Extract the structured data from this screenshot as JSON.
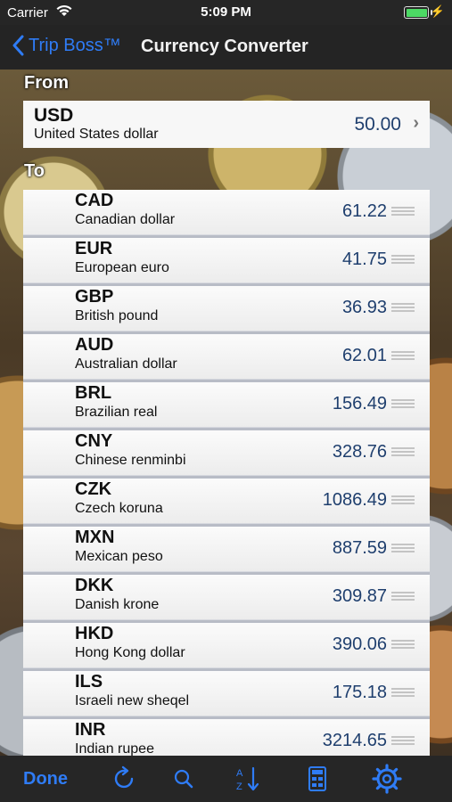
{
  "status": {
    "carrier": "Carrier",
    "time": "5:09 PM"
  },
  "nav": {
    "back_label": "Trip Boss™",
    "title": "Currency Converter"
  },
  "from": {
    "section_label": "From",
    "code": "USD",
    "name": "United States dollar",
    "amount": "50.00"
  },
  "to": {
    "section_label": "To",
    "rows": [
      {
        "code": "CAD",
        "name": "Canadian dollar",
        "value": "61.22"
      },
      {
        "code": "EUR",
        "name": "European euro",
        "value": "41.75"
      },
      {
        "code": "GBP",
        "name": "British pound",
        "value": "36.93"
      },
      {
        "code": "AUD",
        "name": "Australian dollar",
        "value": "62.01"
      },
      {
        "code": "BRL",
        "name": "Brazilian real",
        "value": "156.49"
      },
      {
        "code": "CNY",
        "name": "Chinese renminbi",
        "value": "328.76"
      },
      {
        "code": "CZK",
        "name": "Czech koruna",
        "value": "1086.49"
      },
      {
        "code": "MXN",
        "name": "Mexican peso",
        "value": "887.59"
      },
      {
        "code": "DKK",
        "name": "Danish krone",
        "value": "309.87"
      },
      {
        "code": "HKD",
        "name": "Hong Kong dollar",
        "value": "390.06"
      },
      {
        "code": "ILS",
        "name": "Israeli new sheqel",
        "value": "175.18"
      },
      {
        "code": "INR",
        "name": "Indian rupee",
        "value": "3214.65"
      }
    ]
  },
  "toolbar": {
    "done_label": "Done",
    "icons": [
      "refresh-icon",
      "search-icon",
      "sort-az-icon",
      "calculator-icon",
      "gear-icon"
    ]
  },
  "colors": {
    "accent": "#2f7cf6",
    "value_text": "#1f3f6e",
    "bar_bg": "#262626",
    "battery": "#4cd964"
  }
}
